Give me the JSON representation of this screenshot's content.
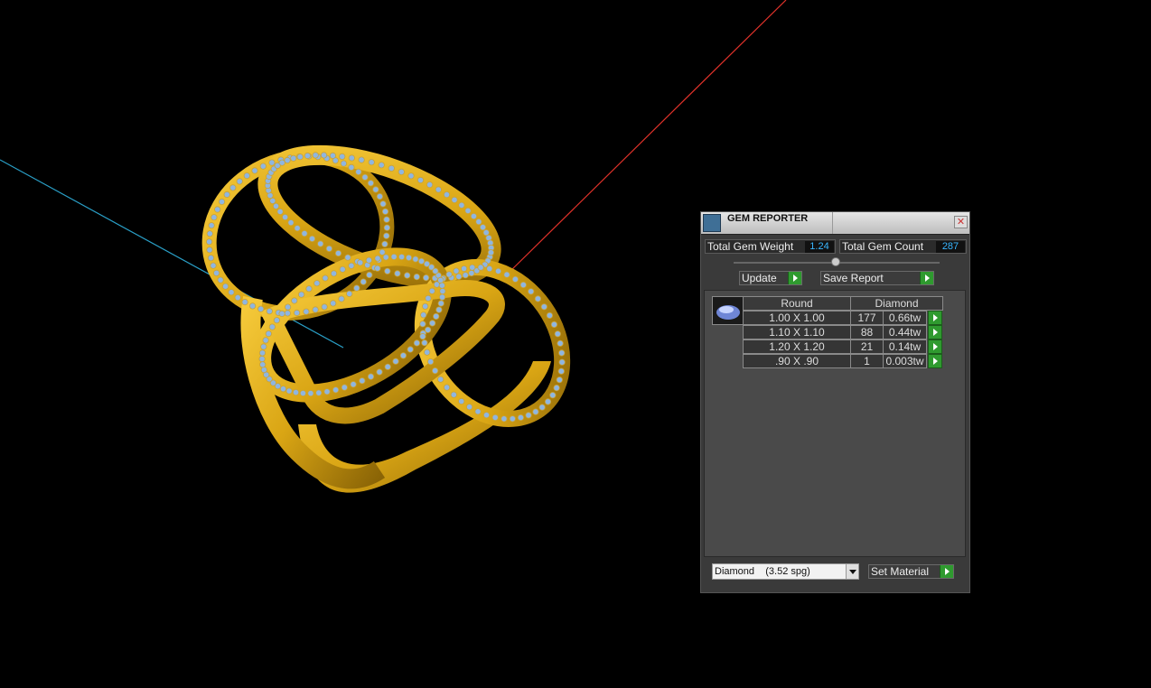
{
  "panel": {
    "title": "GEM REPORTER",
    "close_glyph": "✕",
    "total_weight_label": "Total Gem Weight",
    "total_weight_value": "1.24",
    "total_count_label": "Total Gem Count",
    "total_count_value": "287",
    "update_label": "Update",
    "save_report_label": "Save Report",
    "table": {
      "col_shape": "Round",
      "col_material": "Diamond",
      "rows": [
        {
          "size": "1.00 X 1.00",
          "count": "177",
          "weight": "0.66tw"
        },
        {
          "size": "1.10 X 1.10",
          "count": "88",
          "weight": "0.44tw"
        },
        {
          "size": "1.20 X 1.20",
          "count": "21",
          "weight": "0.14tw"
        },
        {
          "size": ".90 X .90",
          "count": "1",
          "weight": "0.003tw"
        }
      ]
    },
    "material_select": "Diamond    (3.52 spg)",
    "set_material_label": "Set Material"
  },
  "icons": {
    "title": "gem-reporter-icon",
    "thumbnail": "round-gem-icon",
    "go": "play-arrow-icon"
  },
  "colors": {
    "background": "#000000",
    "gold": "#d9a514",
    "gem_blue": "#8fb6e0",
    "axis_red": "#e0322a",
    "axis_cyan": "#2aa0c8",
    "value_text": "#39b6ff",
    "go_green": "#2f9a2f"
  }
}
